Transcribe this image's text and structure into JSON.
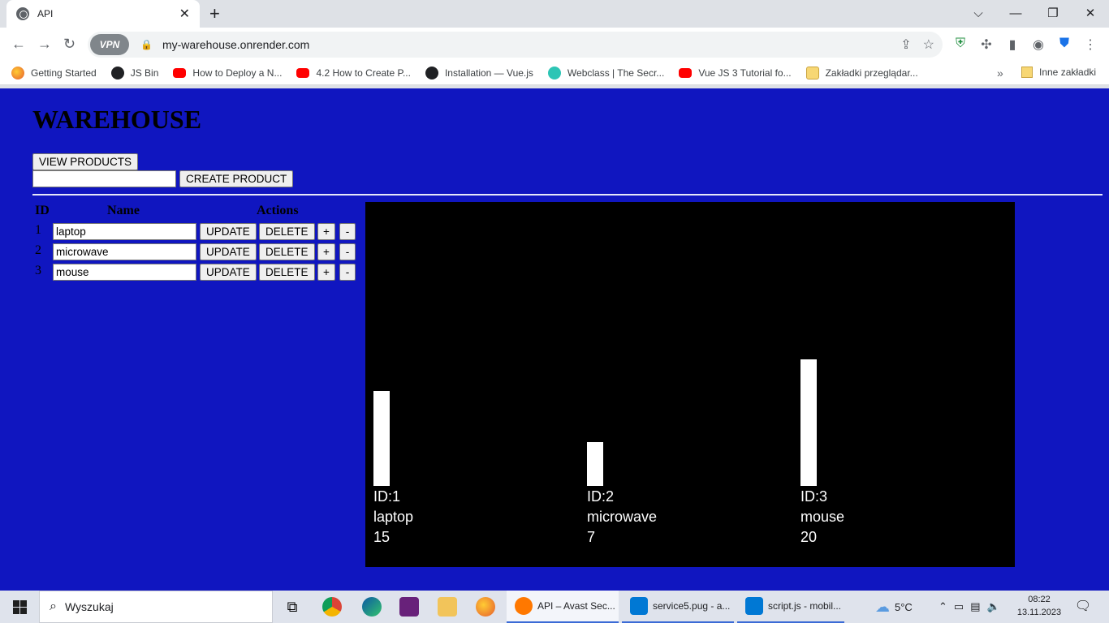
{
  "browser": {
    "tab_title": "API",
    "tab_close": "✕",
    "new_tab": "+",
    "window_controls": [
      "⌵",
      "—",
      "❐",
      "✕"
    ],
    "url": "my-warehouse.onrender.com",
    "vpn_label": "VPN",
    "bookmarks": [
      {
        "label": "Getting Started",
        "icon": "firefox-icon"
      },
      {
        "label": "JS Bin",
        "icon": "globe-icon"
      },
      {
        "label": "How to Deploy a N...",
        "icon": "youtube-icon"
      },
      {
        "label": "4.2 How to Create P...",
        "icon": "youtube-icon"
      },
      {
        "label": "Installation — Vue.js",
        "icon": "globe-icon"
      },
      {
        "label": "Webclass | The Secr...",
        "icon": "webclass-icon"
      },
      {
        "label": "Vue JS 3 Tutorial fo...",
        "icon": "youtube-icon"
      },
      {
        "label": "Zakładki przeglądar...",
        "icon": "folder-icon"
      }
    ],
    "bookmarks_more": "»",
    "other_bookmarks": "Inne zakładki"
  },
  "page": {
    "title": "WAREHOUSE",
    "view_products_label": "VIEW PRODUCTS",
    "create_input_value": "",
    "create_product_label": "CREATE PRODUCT",
    "table_headers": {
      "id": "ID",
      "name": "Name",
      "actions": "Actions"
    },
    "products": [
      {
        "id": "1",
        "name": "laptop",
        "update": "UPDATE",
        "delete": "DELETE",
        "plus": "+",
        "minus": "-"
      },
      {
        "id": "2",
        "name": "microwave",
        "update": "UPDATE",
        "delete": "DELETE",
        "plus": "+",
        "minus": "-"
      },
      {
        "id": "3",
        "name": "mouse",
        "update": "UPDATE",
        "delete": "DELETE",
        "plus": "+",
        "minus": "-"
      }
    ]
  },
  "chart_data": {
    "type": "bar",
    "categories": [
      "laptop",
      "microwave",
      "mouse"
    ],
    "id_labels": [
      "ID:1",
      "ID:2",
      "ID:3"
    ],
    "values": [
      15,
      7,
      20
    ],
    "title": "",
    "xlabel": "",
    "ylabel": "",
    "ylim": [
      0,
      45
    ],
    "bar_color": "#ffffff",
    "background": "#000000"
  },
  "taskbar": {
    "search_placeholder": "Wyszukaj",
    "apps": [
      {
        "label": "API – Avast Sec...",
        "active": true
      },
      {
        "label": "service5.pug - a...",
        "active": false
      },
      {
        "label": "script.js - mobil...",
        "active": false
      }
    ],
    "weather": "5°C",
    "time": "08:22",
    "date": "13.11.2023"
  },
  "colors": {
    "page_background": "#1016c0",
    "chrome_background": "#dee1e6"
  }
}
